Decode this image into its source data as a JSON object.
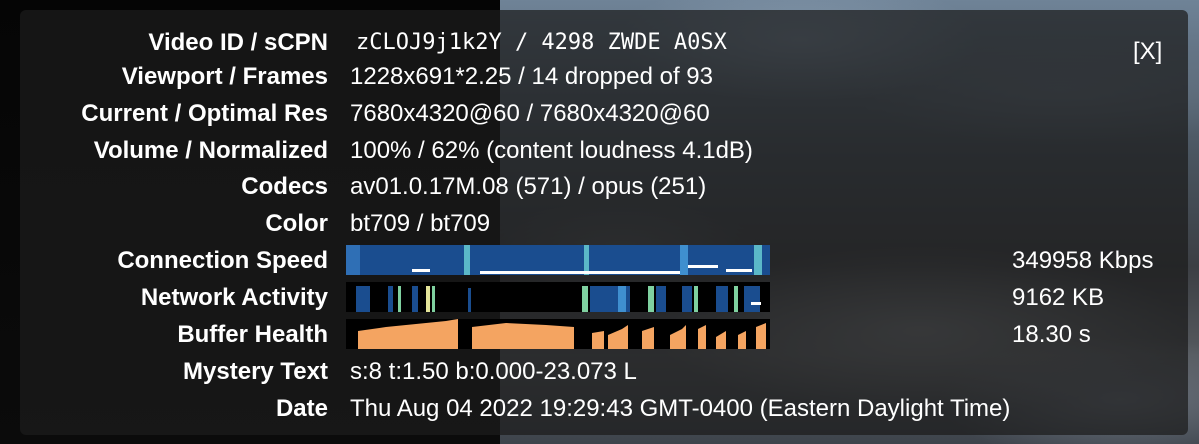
{
  "close_label": "[X]",
  "stats": {
    "video_id": {
      "label": "Video ID / sCPN",
      "value": "zCLOJ9j1k2Y / 4298 ZWDE A0SX"
    },
    "viewport": {
      "label": "Viewport / Frames",
      "value": "1228x691*2.25 / 14 dropped of 93"
    },
    "resolution": {
      "label": "Current / Optimal Res",
      "value": "7680x4320@60 / 7680x4320@60"
    },
    "volume": {
      "label": "Volume / Normalized",
      "value": "100% / 62% (content loudness 4.1dB)"
    },
    "codecs": {
      "label": "Codecs",
      "value": "av01.0.17M.08 (571) / opus (251)"
    },
    "color": {
      "label": "Color",
      "value": "bt709 / bt709"
    },
    "connection_speed": {
      "label": "Connection Speed",
      "value": "349958 Kbps"
    },
    "network_activity": {
      "label": "Network Activity",
      "value": "9162 KB"
    },
    "buffer_health": {
      "label": "Buffer Health",
      "value": "18.30 s"
    },
    "mystery_text": {
      "label": "Mystery Text",
      "value": "s:8 t:1.50 b:0.000-23.073 L"
    },
    "date": {
      "label": "Date",
      "value": "Thu Aug 04 2022 19:29:43 GMT-0400 (Eastern Daylight Time)"
    }
  },
  "colors": {
    "connection_fill": "#1a4d8f",
    "connection_line": "#ffffff",
    "connection_accent": "#5bb8c8",
    "network_fill": "#1a4d8f",
    "network_accent": "#7fd1a0",
    "buffer_fill": "#f4a461"
  }
}
